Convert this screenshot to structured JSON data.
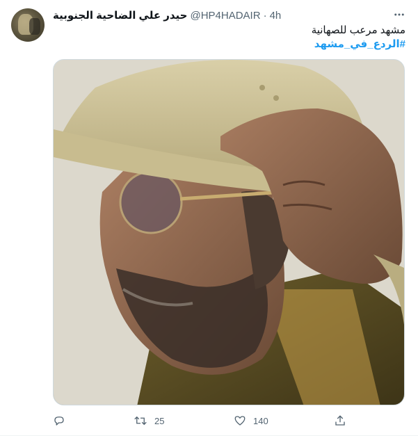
{
  "tweet": {
    "author": {
      "display_name": "حيدر علي الضاحية الجنوبية",
      "handle": "@HP4HADAIR",
      "separator": "·",
      "timestamp": "4h",
      "avatar_icon": "profile-avatar"
    },
    "text_line": "مشهد مرعب للصهانية",
    "hashtag": "#الردع_في_مشهد",
    "media_description_icon": "photo",
    "actions": {
      "reply": {
        "icon": "reply-icon",
        "count": ""
      },
      "retweet": {
        "icon": "retweet-icon",
        "count": "25"
      },
      "like": {
        "icon": "heart-icon",
        "count": "140"
      },
      "share": {
        "icon": "share-icon",
        "count": ""
      }
    },
    "more_icon": "more-icon"
  },
  "colors": {
    "text_primary": "#0f1419",
    "text_secondary": "#536471",
    "link": "#1d9bf0",
    "border": "#cfd9de"
  }
}
